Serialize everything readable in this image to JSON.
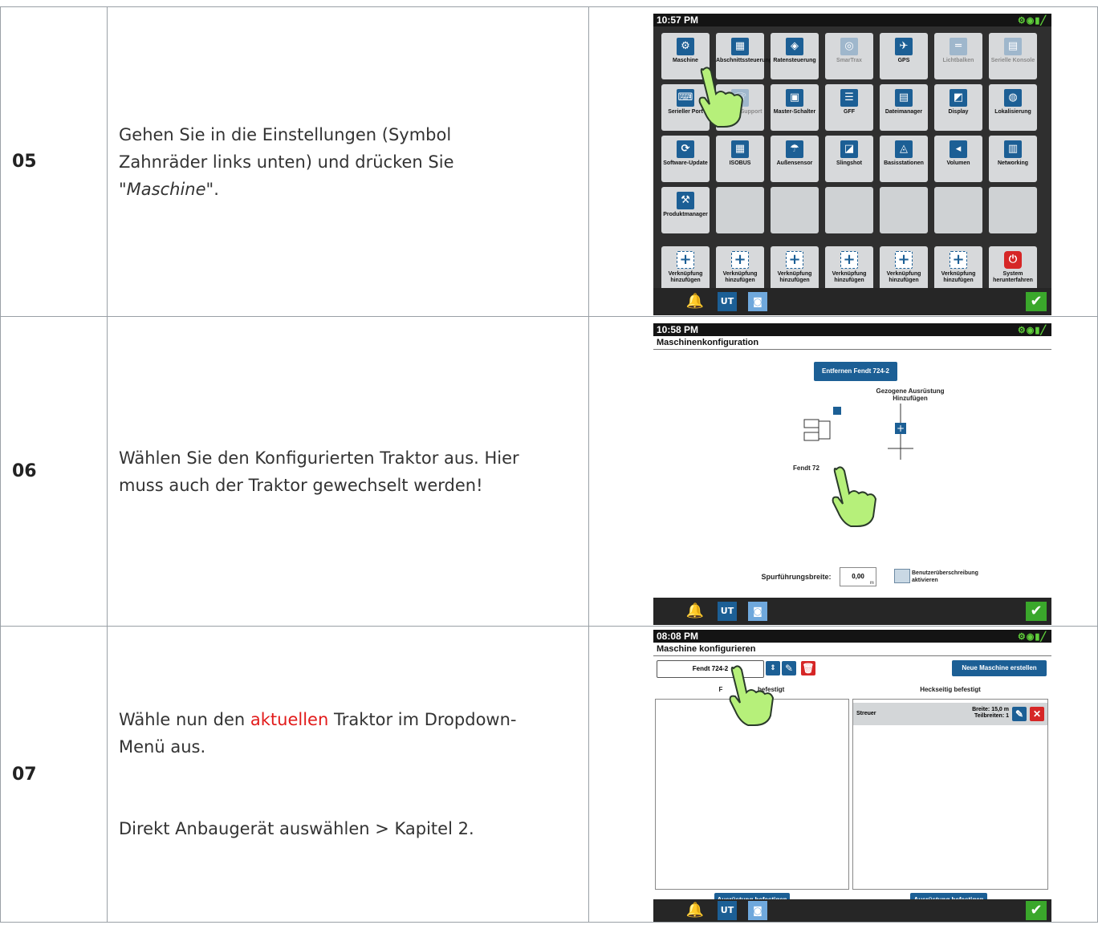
{
  "rows": [
    {
      "num": "05",
      "text_parts": [
        "Gehen Sie in die Einstellungen (Symbol Zahnräder links unten) und drücken Sie \"",
        "Maschine",
        "\"."
      ],
      "screen": {
        "time": "10:57 PM",
        "tiles": [
          [
            "Maschine",
            "Abschnittssteuerung",
            "Ratensteuerung",
            "SmarTrax",
            "GPS",
            "Lichtbalken",
            "Serielle Konsole"
          ],
          [
            "Serieller Port",
            "Remote-Support",
            "Master-Schalter",
            "GFF",
            "Dateimanager",
            "Display",
            "Lokalisierung"
          ],
          [
            "Software-Update",
            "ISOBUS",
            "Außensensor",
            "Slingshot",
            "Basisstationen",
            "Volumen",
            "Networking"
          ],
          [
            "Produktmanager",
            "",
            "",
            "",
            "",
            "",
            ""
          ]
        ],
        "shortcuts": [
          "Verknüpfung hinzufügen",
          "Verknüpfung hinzufügen",
          "Verknüpfung hinzufügen",
          "Verknüpfung hinzufügen",
          "Verknüpfung hinzufügen",
          "Verknüpfung hinzufügen",
          "System herunterfahren"
        ]
      }
    },
    {
      "num": "06",
      "text": "Wählen Sie den Konfigurierten Traktor aus. Hier muss auch der Traktor gewechselt werden!",
      "screen": {
        "time": "10:58 PM",
        "title": "Maschinenkonfiguration",
        "remove_button": "Entfernen Fendt 724-2",
        "towed_label": "Gezogene Ausrüstung Hinzufügen",
        "tractor_label": "Fendt 72",
        "track_width_label": "Spurführungsbreite:",
        "track_width_value": "0,00",
        "track_width_unit": "m",
        "override_label": "Benutzerüberschreibung aktivieren"
      }
    },
    {
      "num": "07",
      "text_before": "Wähle nun den ",
      "text_highlight": "aktuellen",
      "text_after": " Traktor im Dropdown-Menü aus.",
      "text2": "Direkt Anbaugerät auswählen > Kapitel 2.",
      "screen": {
        "time": "08:08 PM",
        "title": "Maschine konfigurieren",
        "dropdown_value": "Fendt 724-2",
        "new_machine_button": "Neue Maschine erstellen",
        "front_label": "F",
        "front_label_rest": "befestigt",
        "rear_label": "Heckseitig befestigt",
        "rear_item": "Streuer",
        "rear_item_details": "Breite: 15,0 m Teilbreiten: 1",
        "attach_button": "Ausrüstung befestigen"
      }
    }
  ],
  "colors": {
    "accent_blue": "#1c5f95",
    "highlight_red": "#e21b1b",
    "check_green": "#3aa72b"
  }
}
